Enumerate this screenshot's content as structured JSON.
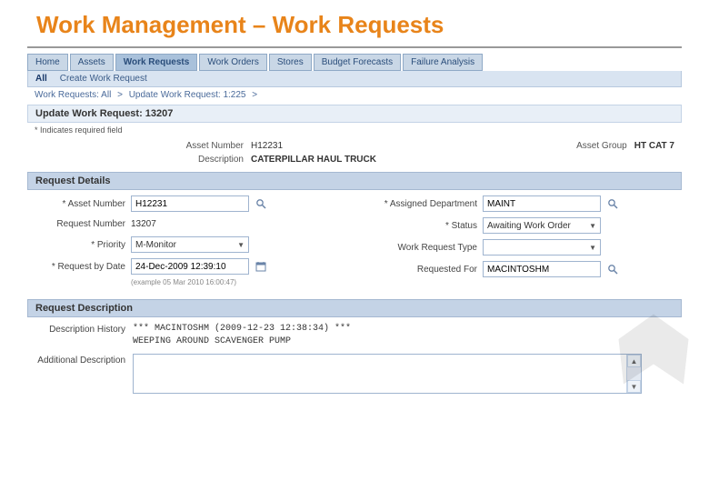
{
  "slide": {
    "title": "Work Management – Work Requests"
  },
  "tabs": {
    "items": [
      {
        "label": "Home"
      },
      {
        "label": "Assets"
      },
      {
        "label": "Work Requests"
      },
      {
        "label": "Work Orders"
      },
      {
        "label": "Stores"
      },
      {
        "label": "Budget Forecasts"
      },
      {
        "label": "Failure Analysis"
      }
    ],
    "active_index": 2
  },
  "subbar": {
    "all": "All",
    "create": "Create Work Request"
  },
  "breadcrumb": {
    "parts": [
      "Work Requests: All",
      ">",
      "Update Work Request: 1:225",
      ">"
    ]
  },
  "page": {
    "title": "Update Work Request: 13207",
    "required_note": "* Indicates required field"
  },
  "asset_info": {
    "asset_number_label": "Asset Number",
    "asset_number": "H12231",
    "description_label": "Description",
    "description": "CATERPILLAR HAUL TRUCK",
    "asset_group_label": "Asset Group",
    "asset_group": "HT CAT 7"
  },
  "sections": {
    "request_details": "Request Details",
    "request_description": "Request Description"
  },
  "details": {
    "left": {
      "asset_number_label": "* Asset Number",
      "asset_number": "H12231",
      "request_number_label": "Request Number",
      "request_number": "13207",
      "priority_label": "* Priority",
      "priority": "M-Monitor",
      "request_by_date_label": "* Request by Date",
      "request_by_date": "24-Dec-2009 12:39:10",
      "example_hint": "(example 05 Mar 2010 16:00:47)"
    },
    "right": {
      "assigned_dept_label": "* Assigned Department",
      "assigned_dept": "MAINT",
      "status_label": "* Status",
      "status": "Awaiting Work Order",
      "work_request_type_label": "Work Request Type",
      "work_request_type": "",
      "requested_for_label": "Requested For",
      "requested_for": "MACINTOSHM"
    }
  },
  "description": {
    "history_label": "Description History",
    "history_line1": "*** MACINTOSHM  (2009-12-23 12:38:34) ***",
    "history_line2": "WEEPING AROUND SCAVENGER PUMP",
    "additional_label": "Additional Description",
    "additional_value": ""
  },
  "icons": {
    "search": "search-icon",
    "calendar": "calendar-icon",
    "chevron": "chevron-down-icon"
  }
}
